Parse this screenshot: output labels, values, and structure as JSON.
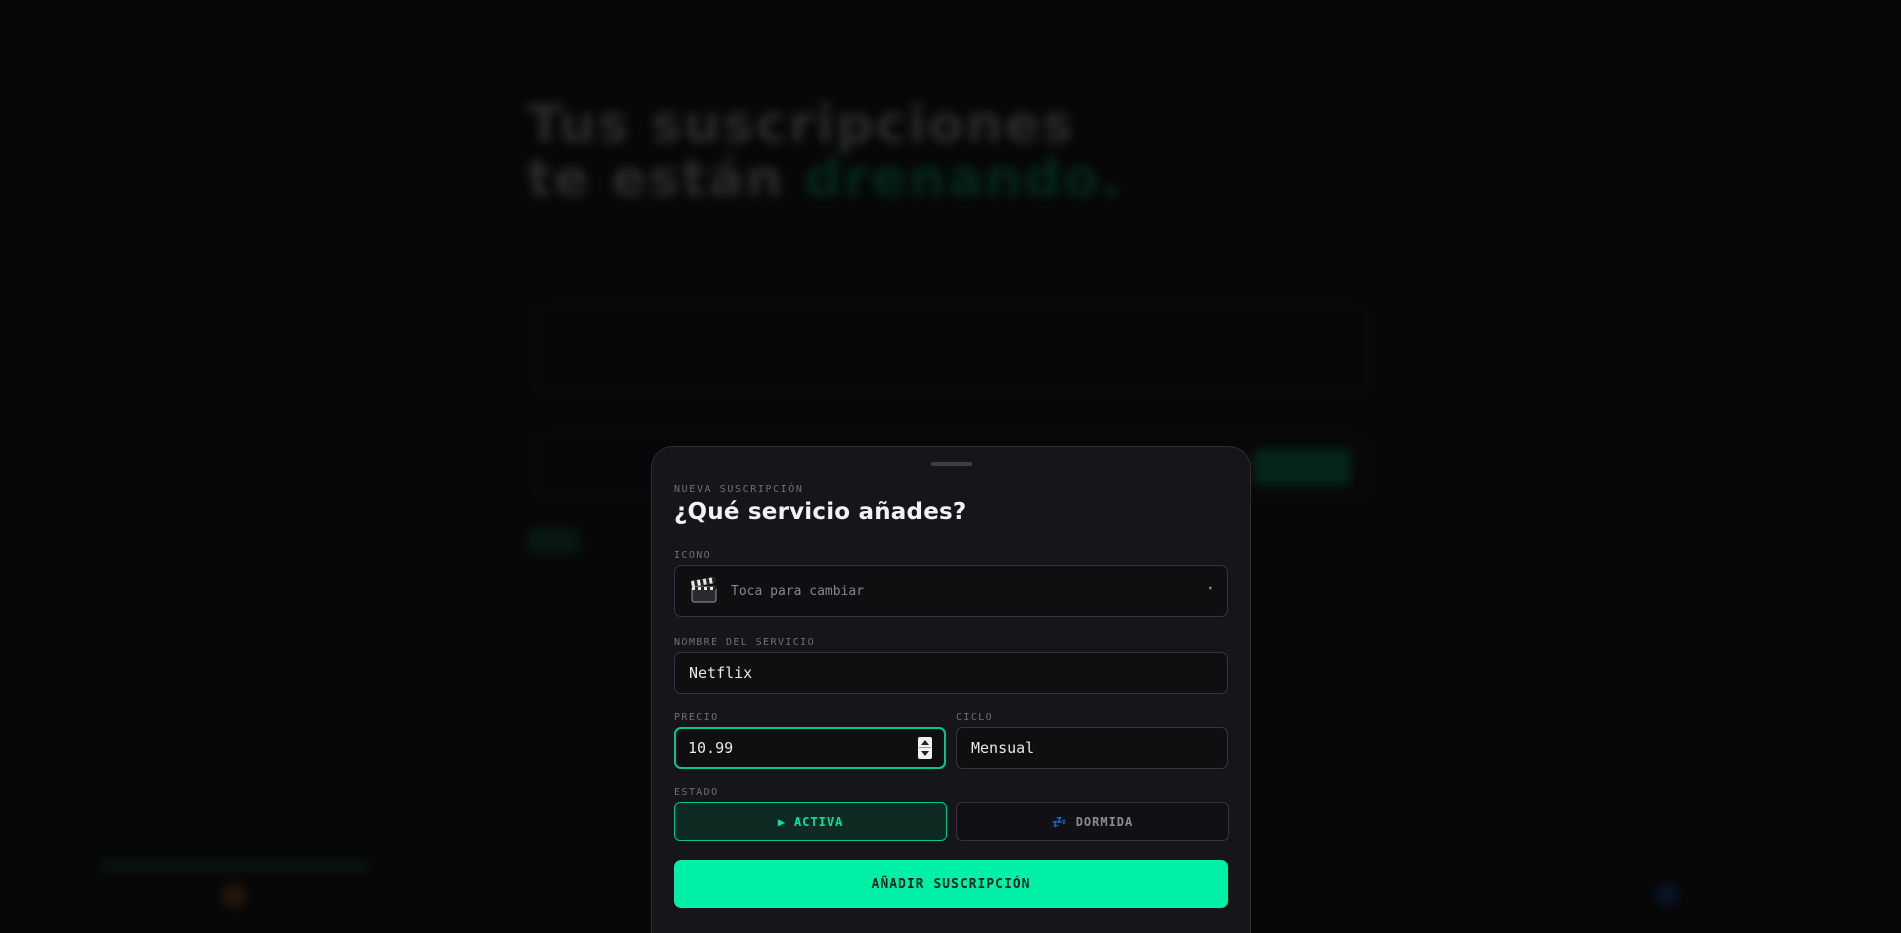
{
  "background": {
    "hero_line1": "Tus suscripciones",
    "hero_line2_prefix": "te están ",
    "hero_line2_accent": "drenando."
  },
  "modal": {
    "eyebrow": "NUEVA SUSCRIPCIÓN",
    "title": "¿Qué servicio añades?",
    "icon_label": "ICONO",
    "icon_emoji": "clapper-board-icon",
    "icon_hint": "Toca para cambiar",
    "icon_caret": "▾",
    "name_label": "NOMBRE DEL SERVICIO",
    "name_value": "Netflix",
    "price_label": "PRECIO",
    "price_value": "10.99",
    "cycle_label": "CICLO",
    "cycle_value": "Mensual",
    "state_label": "ESTADO",
    "state_active_icon": "▶",
    "state_active": "ACTIVA",
    "state_sleep_icon": "💤",
    "state_sleep": "DORMIDA",
    "submit": "AÑADIR SUSCRIPCIÓN"
  },
  "colors": {
    "accent": "#00f0a8",
    "panel": "#16161a",
    "background": "#0b0b0c"
  }
}
